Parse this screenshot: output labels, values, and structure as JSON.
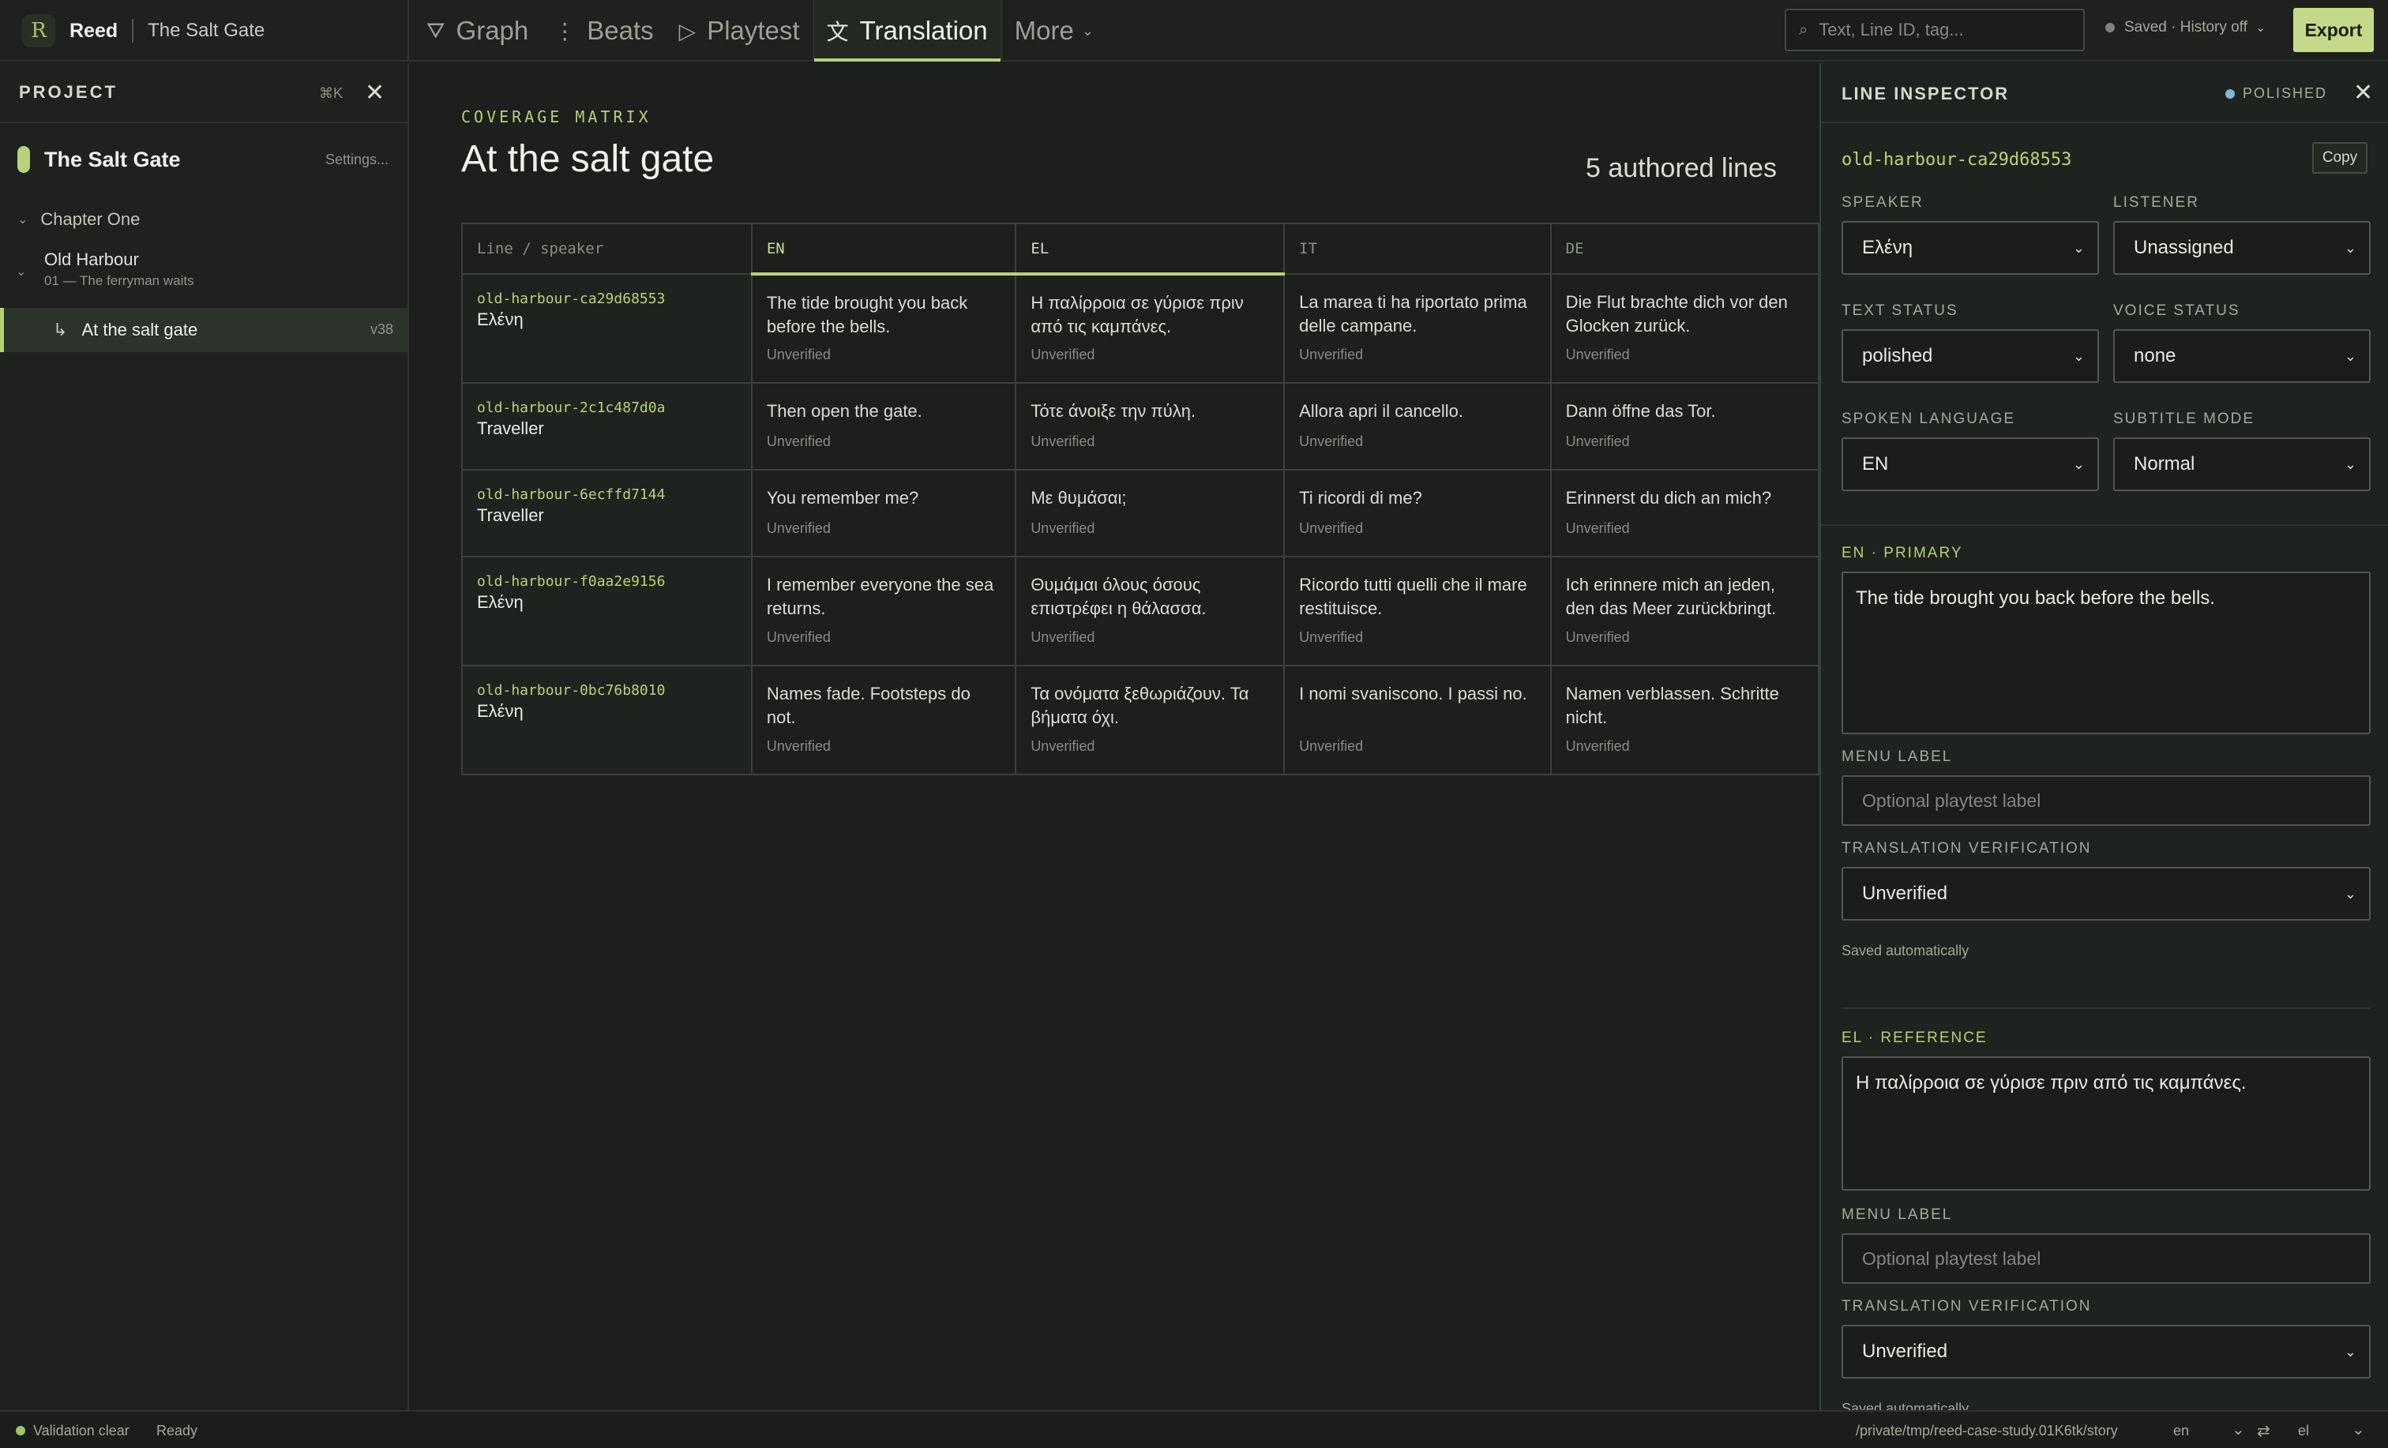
{
  "app": {
    "name": "Reed",
    "logo_glyph": "R",
    "project_title": "The Salt Gate"
  },
  "tabs": [
    {
      "label": "Graph",
      "icon": "graph-icon",
      "glyph": "⛛"
    },
    {
      "label": "Beats",
      "icon": "beats-icon",
      "glyph": "⋮"
    },
    {
      "label": "Playtest",
      "icon": "play-icon",
      "glyph": "▷"
    },
    {
      "label": "Translation",
      "icon": "translate-icon",
      "glyph": "文"
    },
    {
      "label": "More",
      "icon": "chevron-down-icon",
      "glyph": "⌄"
    }
  ],
  "active_tab": "Translation",
  "search": {
    "placeholder": "Text, Line ID, tag..."
  },
  "save_status": "Saved · History off",
  "export_label": "Export",
  "sidebar": {
    "title": "PROJECT",
    "shortcut": "⌘K",
    "project_name": "The Salt Gate",
    "settings_label": "Settings...",
    "chapter": "Chapter One",
    "section_name": "Old Harbour",
    "section_sub": "01 — The ferryman waits",
    "beat_name": "At the salt gate",
    "beat_version": "v38"
  },
  "main": {
    "kicker": "COVERAGE MATRIX",
    "title": "At the salt gate",
    "count_label": "5 authored lines",
    "columns": [
      "Line / speaker",
      "EN",
      "EL",
      "IT",
      "DE"
    ],
    "rows": [
      {
        "id": "old-harbour-ca29d68553",
        "speaker": "Ελένη",
        "en": "The tide brought you back before the bells.",
        "el": "Η παλίρροια σε γύρισε πριν από τις καμπάνες.",
        "it": "La marea ti ha riportato prima delle campane.",
        "de": "Die Flut brachte dich vor den Glocken zurück.",
        "status": "Unverified"
      },
      {
        "id": "old-harbour-2c1c487d0a",
        "speaker": "Traveller",
        "en": "Then open the gate.",
        "el": "Τότε άνοιξε την πύλη.",
        "it": "Allora apri il cancello.",
        "de": "Dann öffne das Tor.",
        "status": "Unverified"
      },
      {
        "id": "old-harbour-6ecffd7144",
        "speaker": "Traveller",
        "en": "You remember me?",
        "el": "Με θυμάσαι;",
        "it": "Ti ricordi di me?",
        "de": "Erinnerst du dich an mich?",
        "status": "Unverified"
      },
      {
        "id": "old-harbour-f0aa2e9156",
        "speaker": "Ελένη",
        "en": "I remember everyone the sea returns.",
        "el": "Θυμάμαι όλους όσους επιστρέφει η θάλασσα.",
        "it": "Ricordo tutti quelli che il mare restituisce.",
        "de": "Ich erinnere mich an jeden, den das Meer zurückbringt.",
        "status": "Unverified"
      },
      {
        "id": "old-harbour-0bc76b8010",
        "speaker": "Ελένη",
        "en": "Names fade. Footsteps do not.",
        "el": "Τα ονόματα ξεθωριάζουν. Τα βήματα όχι.",
        "it": "I nomi svaniscono. I passi no.",
        "de": "Namen verblassen. Schritte nicht.",
        "status": "Unverified"
      }
    ]
  },
  "inspector": {
    "title": "LINE INSPECTOR",
    "status_badge": "POLISHED",
    "line_id": "old-harbour-ca29d68553",
    "copy_label": "Copy",
    "speaker_label": "SPEAKER",
    "speaker_value": "Ελένη",
    "listener_label": "LISTENER",
    "listener_value": "Unassigned",
    "text_status_label": "TEXT STATUS",
    "text_status_value": "polished",
    "voice_status_label": "VOICE STATUS",
    "voice_status_value": "none",
    "spoken_language_label": "SPOKEN LANGUAGE",
    "spoken_language_value": "EN",
    "subtitle_mode_label": "SUBTITLE MODE",
    "subtitle_mode_value": "Normal",
    "primary_label": "EN · PRIMARY",
    "primary_text": "The tide brought you back before the bells.",
    "menu_label_label": "MENU LABEL",
    "menu_label_placeholder": "Optional playtest label",
    "verification_label": "TRANSLATION VERIFICATION",
    "verification_value": "Unverified",
    "saved_note": "Saved automatically",
    "reference_label": "EL · REFERENCE",
    "reference_text": "Η παλίρροια σε γύρισε πριν από τις καμπάνες.",
    "ref_menu_label_label": "MENU LABEL",
    "ref_menu_label_placeholder": "Optional playtest label",
    "ref_verification_label": "TRANSLATION VERIFICATION",
    "ref_verification_value": "Unverified",
    "ref_saved_note": "Saved automatically"
  },
  "statusbar": {
    "validation": "Validation clear",
    "ready": "Ready",
    "path": "/private/tmp/reed-case-study.01K6tk/story",
    "lang_left": "en",
    "lang_right": "el"
  },
  "colors": {
    "accent": "#b9d27a",
    "export_bg": "#c4d98a",
    "background": "#1c1f1c",
    "polished_dot": "#7fb7d8"
  }
}
